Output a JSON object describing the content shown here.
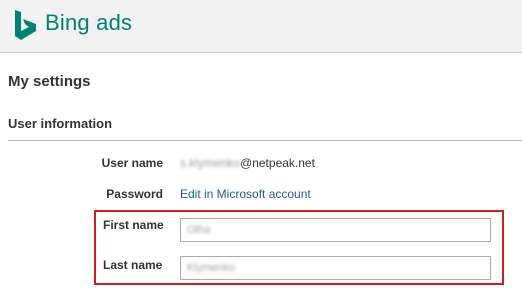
{
  "header": {
    "logo_text": "Bing ads",
    "logo_icon": "bing-logo-icon",
    "brand_color": "#008272"
  },
  "page": {
    "title": "My settings"
  },
  "user_information": {
    "section_title": "User information",
    "user_name_label": "User name",
    "user_name_prefix": "s.klymenko",
    "user_name_suffix": "@netpeak.net",
    "password_label": "Password",
    "password_link": "Edit in Microsoft account",
    "first_name_label": "First name",
    "first_name_value": "Olha",
    "last_name_label": "Last name",
    "last_name_value": "Klymenko"
  },
  "highlight_color": "#cc1f1f"
}
